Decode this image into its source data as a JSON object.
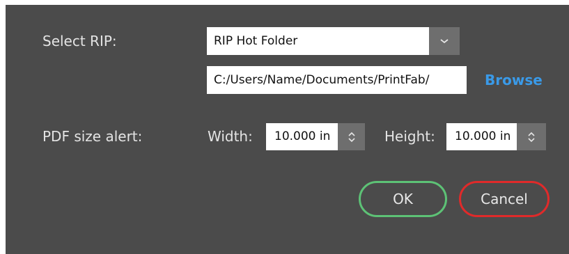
{
  "rip": {
    "label": "Select RIP:",
    "selected": "RIP Hot Folder",
    "path": "C:/Users/Name/Documents/PrintFab/",
    "browse_label": "Browse"
  },
  "pdf_alert": {
    "label": "PDF size alert:",
    "width_label": "Width:",
    "width_value": "10.000 in",
    "height_label": "Height:",
    "height_value": "10.000 in"
  },
  "buttons": {
    "ok_label": "OK",
    "cancel_label": "Cancel"
  },
  "colors": {
    "background": "#4b4b4b",
    "link": "#3a9ae8",
    "ok_border": "#5dc276",
    "cancel_border": "#e02a2a"
  },
  "icons": {
    "select_dropdown": "chevron-down-icon",
    "width_spinner": "spinner-up-down-icon",
    "height_spinner": "spinner-up-down-icon"
  }
}
